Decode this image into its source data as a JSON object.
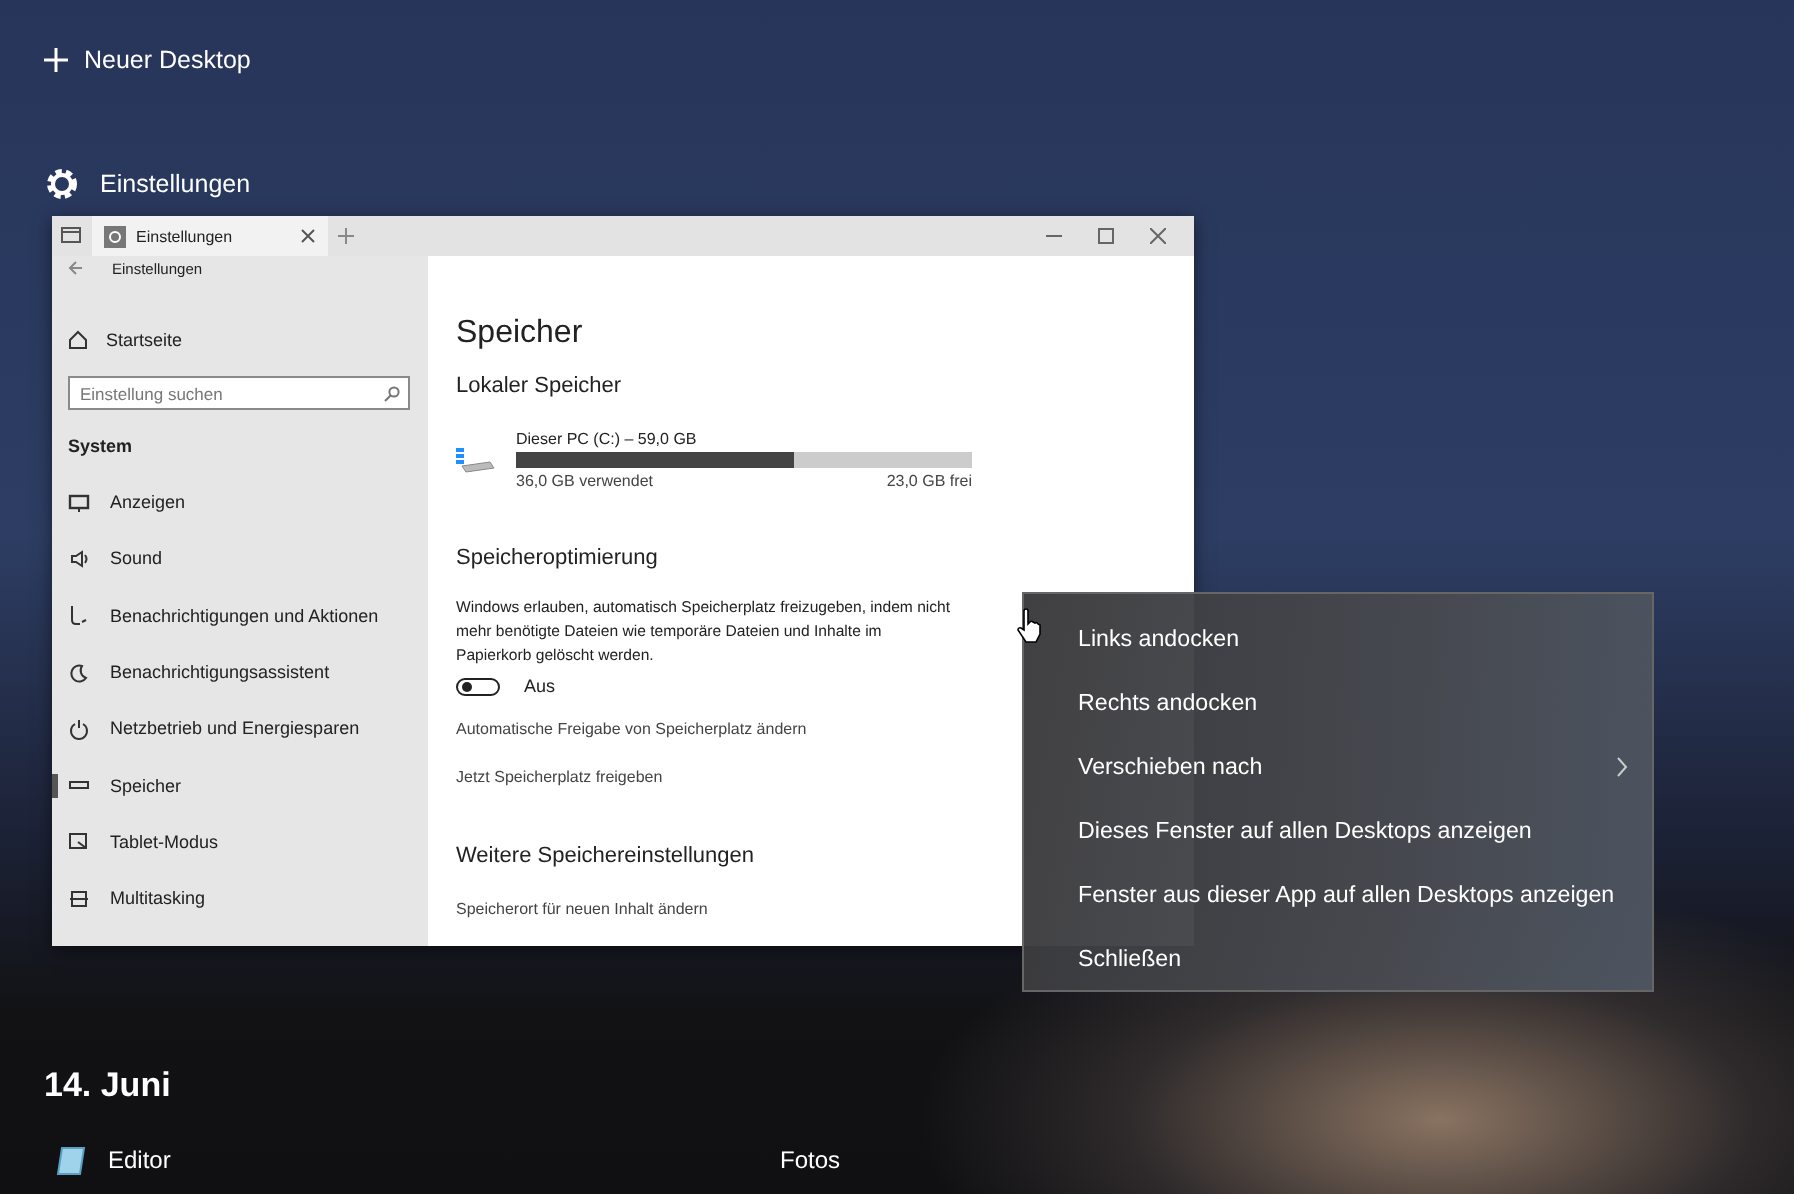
{
  "new_desktop": {
    "label": "Neuer Desktop"
  },
  "window_group": {
    "title": "Einstellungen"
  },
  "window": {
    "tab_title": "Einstellungen",
    "nav_title": "Einstellungen",
    "sidebar": {
      "home": "Startseite",
      "search": {
        "placeholder": "Einstellung suchen"
      },
      "section": "System",
      "items": [
        {
          "label": "Anzeigen",
          "selected": false
        },
        {
          "label": "Sound",
          "selected": false
        },
        {
          "label": "Benachrichtigungen und Aktionen",
          "selected": false
        },
        {
          "label": "Benachrichtigungsassistent",
          "selected": false
        },
        {
          "label": "Netzbetrieb und Energiesparen",
          "selected": false
        },
        {
          "label": "Speicher",
          "selected": true
        },
        {
          "label": "Tablet-Modus",
          "selected": false
        },
        {
          "label": "Multitasking",
          "selected": false
        }
      ]
    },
    "content": {
      "title": "Speicher",
      "local_heading": "Lokaler Speicher",
      "drive": {
        "name": "Dieser PC (C:) – 59,0 GB",
        "level": 0.61,
        "used": "36,0 GB verwendet",
        "free": "23,0 GB frei"
      },
      "optimization": {
        "heading": "Speicheroptimierung",
        "description": "Windows erlauben, automatisch Speicherplatz freizugeben, indem nicht mehr benötigte Dateien wie temporäre Dateien und Inhalte im Papierkorb gelöscht werden.",
        "toggle": {
          "on": false,
          "label": "Aus"
        },
        "links": [
          "Automatische Freigabe von Speicherplatz ändern",
          "Jetzt Speicherplatz freigeben"
        ]
      },
      "more": {
        "heading": "Weitere Speichereinstellungen",
        "links": [
          "Speicherort für neuen Inhalt ändern"
        ]
      }
    }
  },
  "context_menu": {
    "items": [
      {
        "label": "Links andocken",
        "submenu": false
      },
      {
        "label": "Rechts andocken",
        "submenu": false
      },
      {
        "label": "Verschieben nach",
        "submenu": true
      },
      {
        "label": "Dieses Fenster auf allen Desktops anzeigen",
        "submenu": false
      },
      {
        "label": "Fenster aus dieser App auf allen Desktops anzeigen",
        "submenu": false
      },
      {
        "label": "Schließen",
        "submenu": false
      }
    ]
  },
  "timeline": {
    "date": "14. Juni",
    "apps": [
      "Editor",
      "Fotos"
    ]
  }
}
